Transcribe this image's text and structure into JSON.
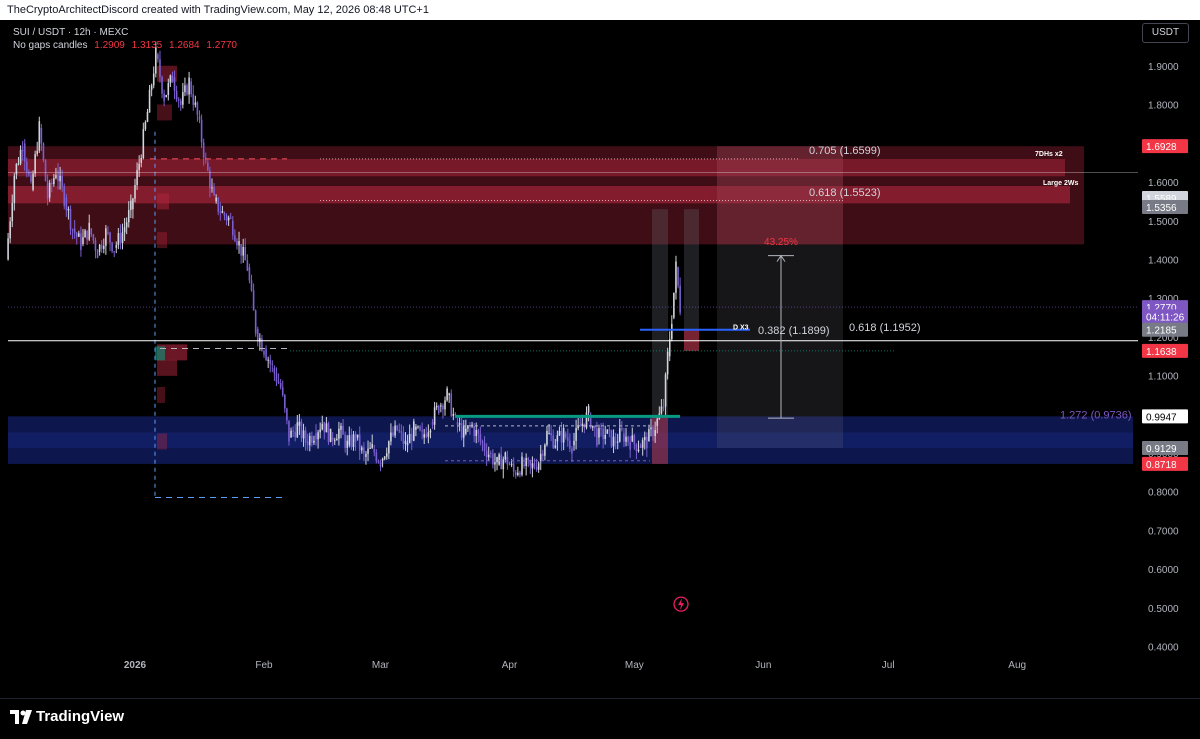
{
  "header": {
    "attribution": "TheCryptoArchitectDiscord created with TradingView.com, May 12, 2026 08:48 UTC+1",
    "symbol_line": "SUI / USDT · 12h · MEXC",
    "ohlc_prefix": "No gaps candles",
    "ohlc_values": [
      "1.2909",
      "1.3135",
      "1.2684",
      "1.2770"
    ],
    "currency_button": "USDT"
  },
  "footer": {
    "logo_text": "TradingView"
  },
  "colors": {
    "up_candle": "#d1d4dc",
    "down_candle": "#7b5fd1",
    "supply_zone": "#b2263d",
    "demand_zone": "#1a2a8c",
    "price_badge": "#7e57c2",
    "red_badge": "#f23645"
  },
  "chart_data": {
    "type": "candlestick",
    "y_axis": {
      "ylim": [
        0.36,
        2.02
      ],
      "ticks": [
        "1.9000",
        "1.8000",
        "1.7000",
        "1.6000",
        "1.5000",
        "1.4000",
        "1.3000",
        "1.2000",
        "1.1000",
        "1.0000",
        "0.9000",
        "0.8000",
        "0.7000",
        "0.6000",
        "0.5000",
        "0.4000"
      ]
    },
    "x_axis": {
      "ticks": [
        {
          "label": "2026",
          "date": "2026-01-01"
        },
        {
          "label": "Feb",
          "date": "2026-02-01"
        },
        {
          "label": "Mar",
          "date": "2026-03-01"
        },
        {
          "label": "Apr",
          "date": "2026-04-01"
        },
        {
          "label": "May",
          "date": "2026-05-01"
        },
        {
          "label": "Jun",
          "date": "2026-06-01"
        },
        {
          "label": "Jul",
          "date": "2026-07-01"
        },
        {
          "label": "Aug",
          "date": "2026-08-01"
        }
      ]
    },
    "price_path": [
      [
        "2025-12-01",
        1.4
      ],
      [
        "2025-12-03",
        1.62
      ],
      [
        "2025-12-05",
        1.7
      ],
      [
        "2025-12-07",
        1.58
      ],
      [
        "2025-12-09",
        1.74
      ],
      [
        "2025-12-11",
        1.56
      ],
      [
        "2025-12-13",
        1.63
      ],
      [
        "2025-12-15",
        1.56
      ],
      [
        "2025-12-17",
        1.48
      ],
      [
        "2025-12-19",
        1.44
      ],
      [
        "2025-12-21",
        1.48
      ],
      [
        "2025-12-23",
        1.42
      ],
      [
        "2025-12-25",
        1.47
      ],
      [
        "2025-12-27",
        1.43
      ],
      [
        "2025-12-29",
        1.47
      ],
      [
        "2025-12-31",
        1.53
      ],
      [
        "2026-01-02",
        1.65
      ],
      [
        "2026-01-04",
        1.78
      ],
      [
        "2026-01-06",
        1.93
      ],
      [
        "2026-01-08",
        1.82
      ],
      [
        "2026-01-10",
        1.87
      ],
      [
        "2026-01-12",
        1.8
      ],
      [
        "2026-01-14",
        1.86
      ],
      [
        "2026-01-16",
        1.77
      ],
      [
        "2026-01-18",
        1.65
      ],
      [
        "2026-01-20",
        1.55
      ],
      [
        "2026-01-22",
        1.52
      ],
      [
        "2026-01-24",
        1.5
      ],
      [
        "2026-01-26",
        1.44
      ],
      [
        "2026-01-28",
        1.38
      ],
      [
        "2026-01-30",
        1.22
      ],
      [
        "2026-02-01",
        1.17
      ],
      [
        "2026-02-03",
        1.12
      ],
      [
        "2026-02-05",
        1.07
      ],
      [
        "2026-02-07",
        0.94
      ],
      [
        "2026-02-09",
        0.97
      ],
      [
        "2026-02-11",
        0.93
      ],
      [
        "2026-02-13",
        0.95
      ],
      [
        "2026-02-15",
        0.98
      ],
      [
        "2026-02-17",
        0.94
      ],
      [
        "2026-02-19",
        0.96
      ],
      [
        "2026-02-21",
        0.92
      ],
      [
        "2026-02-23",
        0.94
      ],
      [
        "2026-02-25",
        0.89
      ],
      [
        "2026-02-27",
        0.91
      ],
      [
        "2026-03-01",
        0.88
      ],
      [
        "2026-03-03",
        0.93
      ],
      [
        "2026-03-05",
        0.96
      ],
      [
        "2026-03-07",
        0.92
      ],
      [
        "2026-03-09",
        0.96
      ],
      [
        "2026-03-11",
        0.94
      ],
      [
        "2026-03-13",
        0.98
      ],
      [
        "2026-03-15",
        1.02
      ],
      [
        "2026-03-17",
        1.05
      ],
      [
        "2026-03-19",
        0.98
      ],
      [
        "2026-03-21",
        0.95
      ],
      [
        "2026-03-23",
        0.97
      ],
      [
        "2026-03-25",
        0.93
      ],
      [
        "2026-03-27",
        0.9
      ],
      [
        "2026-03-29",
        0.87
      ],
      [
        "2026-03-31",
        0.89
      ],
      [
        "2026-04-02",
        0.85
      ],
      [
        "2026-04-04",
        0.87
      ],
      [
        "2026-04-06",
        0.86
      ],
      [
        "2026-04-08",
        0.88
      ],
      [
        "2026-04-10",
        0.95
      ],
      [
        "2026-04-12",
        0.93
      ],
      [
        "2026-04-14",
        0.95
      ],
      [
        "2026-04-16",
        0.92
      ],
      [
        "2026-04-18",
        0.97
      ],
      [
        "2026-04-20",
        1.0
      ],
      [
        "2026-04-22",
        0.94
      ],
      [
        "2026-04-24",
        0.95
      ],
      [
        "2026-04-26",
        0.93
      ],
      [
        "2026-04-28",
        0.95
      ],
      [
        "2026-04-30",
        0.93
      ],
      [
        "2026-05-02",
        0.92
      ],
      [
        "2026-05-04",
        0.93
      ],
      [
        "2026-05-06",
        0.97
      ],
      [
        "2026-05-08",
        1.02
      ],
      [
        "2026-05-09",
        1.15
      ],
      [
        "2026-05-10",
        1.25
      ],
      [
        "2026-05-11",
        1.38
      ],
      [
        "2026-05-12",
        1.277
      ]
    ],
    "price_axis_labels": [
      {
        "text": "1.6928",
        "value": 1.6928,
        "color": "#f23645"
      },
      {
        "text": "1.5589",
        "value": 1.5589,
        "color": "#d1d4dc"
      },
      {
        "text": "1.5356",
        "value": 1.5356,
        "color": "#787b86"
      },
      {
        "text": "1.2770",
        "value": 1.277,
        "color": "#7e57c2"
      },
      {
        "text": "04:11:26",
        "value": 1.253,
        "color": "#7e57c2"
      },
      {
        "text": "1.2185",
        "value": 1.2185,
        "color": "#787b86"
      },
      {
        "text": "1.1638",
        "value": 1.1638,
        "color": "#f23645"
      },
      {
        "text": "0.9947",
        "value": 0.9947,
        "color": "#ffffff"
      },
      {
        "text": "0.9129",
        "value": 0.9129,
        "color": "#787b86"
      },
      {
        "text": "0.8718",
        "value": 0.8718,
        "color": "#f23645"
      }
    ],
    "fib_levels": [
      {
        "text": "0.705 (1.6599)",
        "value": 1.6599
      },
      {
        "text": "0.618 (1.5523)",
        "value": 1.5523
      },
      {
        "text": "0.382 (1.1899)",
        "value": 1.1899
      },
      {
        "text": "0.618 (1.1952)",
        "value": 1.1952
      },
      {
        "text": "1.272 (0.9736)",
        "value": 0.9736
      }
    ],
    "zone_labels": [
      "7DHs x2",
      "Large 2Ws",
      "D X3"
    ],
    "range_label": "43.25%"
  }
}
